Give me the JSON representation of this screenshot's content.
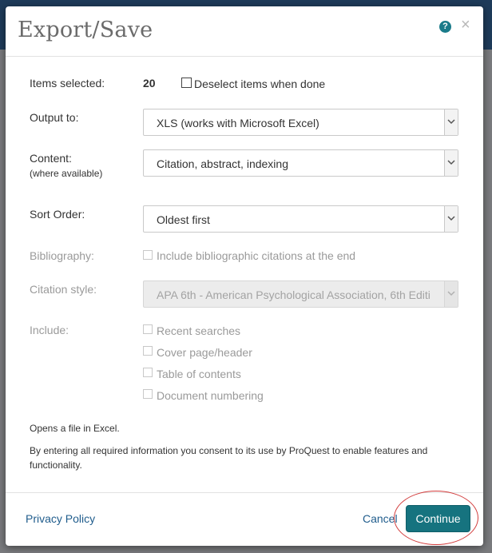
{
  "dialog": {
    "title": "Export/Save",
    "help_icon": "?",
    "close_icon": "×"
  },
  "items_selected": {
    "label": "Items selected:",
    "count": "20",
    "deselect_label": "Deselect items when done"
  },
  "output": {
    "label": "Output to:",
    "value": "XLS (works with Microsoft Excel)"
  },
  "content": {
    "label": "Content:",
    "sublabel": "(where available)",
    "value": "Citation, abstract, indexing"
  },
  "sort_order": {
    "label": "Sort Order:",
    "value": "Oldest first"
  },
  "bibliography": {
    "label": "Bibliography:",
    "option": "Include bibliographic citations at the end"
  },
  "citation_style": {
    "label": "Citation style:",
    "value": "APA 6th - American Psychological Association, 6th Editi"
  },
  "include": {
    "label": "Include:",
    "options": [
      "Recent searches",
      "Cover page/header",
      "Table of contents",
      "Document numbering"
    ]
  },
  "notes": {
    "opens": "Opens a file in Excel.",
    "consent": "By entering all required information you consent to its use by ProQuest to enable features and functionality."
  },
  "footer": {
    "privacy_policy": "Privacy Policy",
    "cancel": "Cancel",
    "continue": "Continue"
  },
  "colors": {
    "accent": "#16737f",
    "link": "#1f5c8c",
    "title": "#6b6b6b",
    "highlight": "#d23c3c"
  }
}
